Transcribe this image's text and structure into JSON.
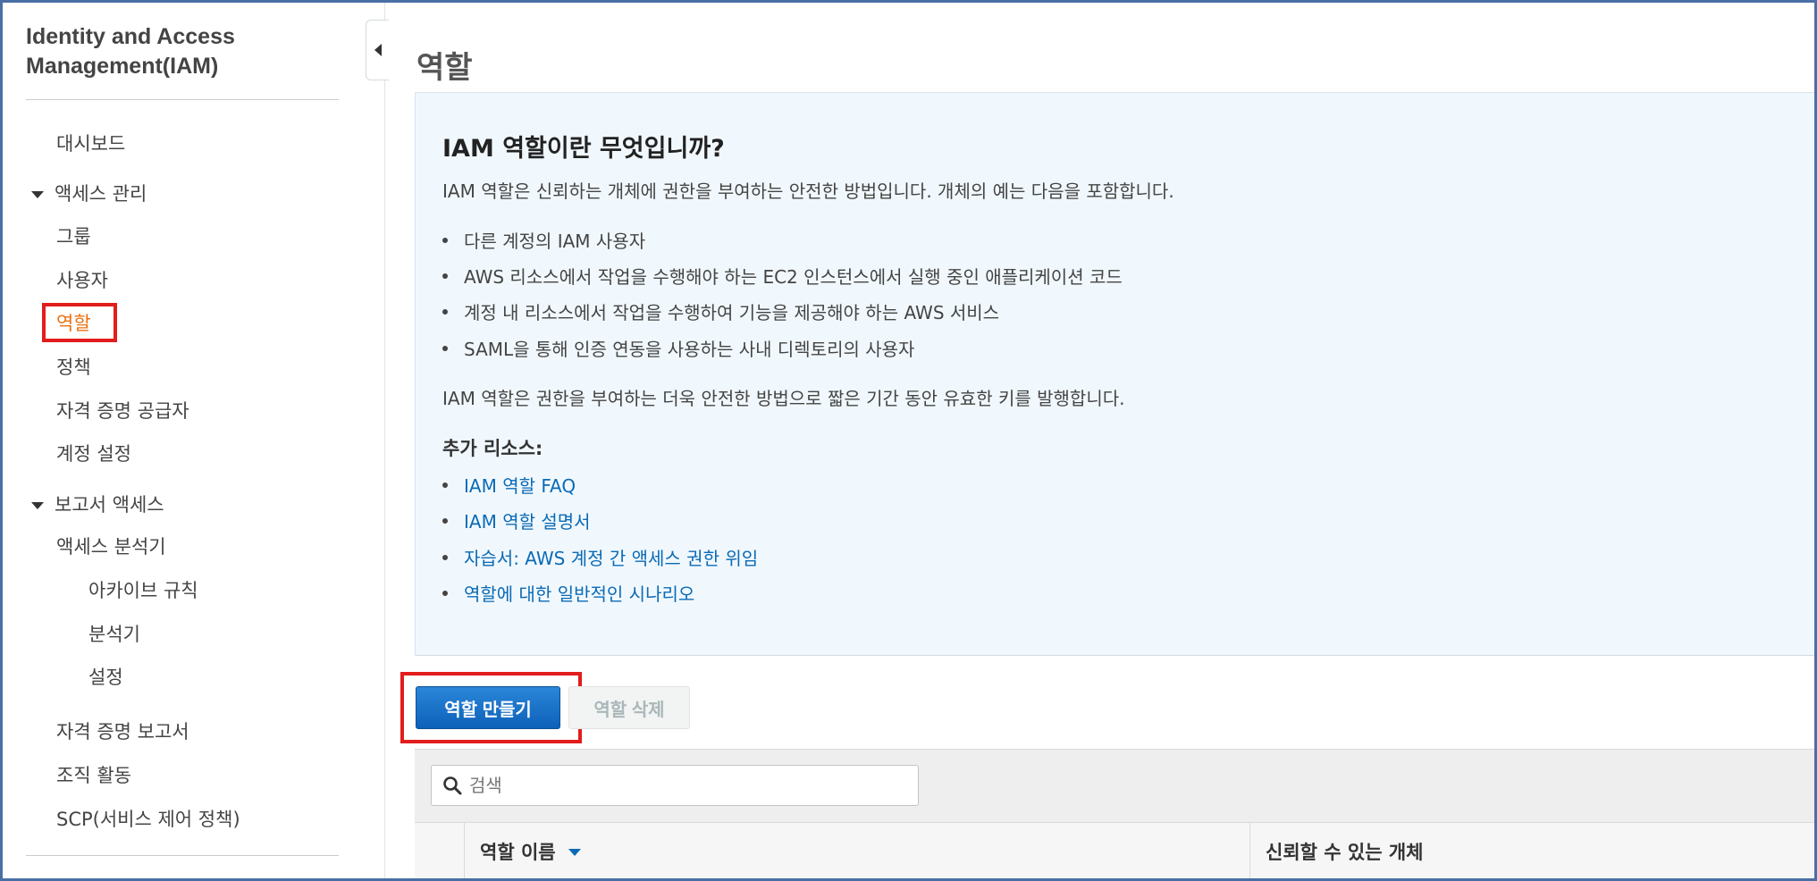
{
  "sidebar": {
    "title": "Identity and Access Management(IAM)",
    "dashboard": "대시보드",
    "access_management": {
      "label": "액세스 관리",
      "items": [
        "그룹",
        "사용자",
        "역할",
        "정책",
        "자격 증명 공급자",
        "계정 설정"
      ],
      "active": "역할"
    },
    "reports": {
      "label": "보고서 액세스",
      "analyzer": "액세스 분석기",
      "analyzer_items": [
        "아카이브 규칙",
        "분석기",
        "설정"
      ],
      "items": [
        "자격 증명 보고서",
        "조직 활동",
        "SCP(서비스 제어 정책)"
      ]
    }
  },
  "page": {
    "title": "역할"
  },
  "info": {
    "heading": "IAM 역할이란 무엇입니까?",
    "intro": "IAM 역할은 신뢰하는 개체에 권한을 부여하는 안전한 방법입니다. 개체의 예는 다음을 포함합니다.",
    "bullets": [
      "다른 계정의 IAM 사용자",
      "AWS 리소스에서 작업을 수행해야 하는 EC2 인스턴스에서 실행 중인 애플리케이션 코드",
      "계정 내 리소스에서 작업을 수행하여 기능을 제공해야 하는 AWS 서비스",
      "SAML을 통해 인증 연동을 사용하는 사내 디렉토리의 사용자"
    ],
    "summary": "IAM 역할은 권한을 부여하는 더욱 안전한 방법으로 짧은 기간 동안 유효한 키를 발행합니다.",
    "resources_heading": "추가 리소스:",
    "links": [
      "IAM 역할 FAQ",
      "IAM 역할 설명서",
      "자습서: AWS 계정 간 액세스 권한 위임",
      "역할에 대한 일반적인 시나리오"
    ]
  },
  "actions": {
    "create_role": "역할 만들기",
    "delete_role": "역할 삭제"
  },
  "search": {
    "placeholder": "검색",
    "value": ""
  },
  "table": {
    "columns": [
      "역할 이름",
      "신뢰할 수 있는 개체"
    ]
  },
  "colors": {
    "active_nav": "#ec7211",
    "link": "#0a6ab6",
    "primary_button": "#1a73c9",
    "info_background": "#f1f8fd",
    "highlight": "#e31c1c"
  }
}
